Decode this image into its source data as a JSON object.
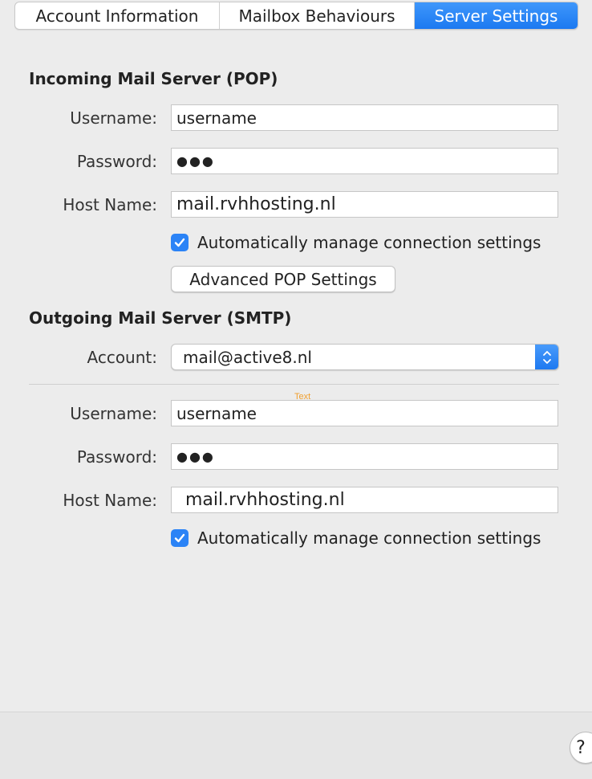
{
  "tabs": [
    {
      "label": "Account Information",
      "active": false
    },
    {
      "label": "Mailbox Behaviours",
      "active": false
    },
    {
      "label": "Server Settings",
      "active": true
    }
  ],
  "incoming": {
    "title": "Incoming Mail Server (POP)",
    "username_label": "Username:",
    "username_value": "username",
    "password_label": "Password:",
    "password_value": "●●●",
    "host_label": "Host Name:",
    "host_value": "mail.rvhhosting.nl",
    "auto_manage_label": "Automatically manage connection settings",
    "auto_manage_checked": true,
    "advanced_button": "Advanced POP Settings"
  },
  "outgoing": {
    "title": "Outgoing Mail Server (SMTP)",
    "account_label": "Account:",
    "account_value": "mail@active8.nl",
    "overlay_text": "Text",
    "username_label": "Username:",
    "username_value": "username",
    "password_label": "Password:",
    "password_value": "●●●",
    "host_label": "Host Name:",
    "host_value": "mail.rvhhosting.nl",
    "auto_manage_label": "Automatically manage connection settings",
    "auto_manage_checked": true
  },
  "footer": {
    "help_label": "?"
  },
  "colors": {
    "accent": "#1b79f1",
    "background": "#ececec",
    "overlay_text": "#f0a030"
  }
}
